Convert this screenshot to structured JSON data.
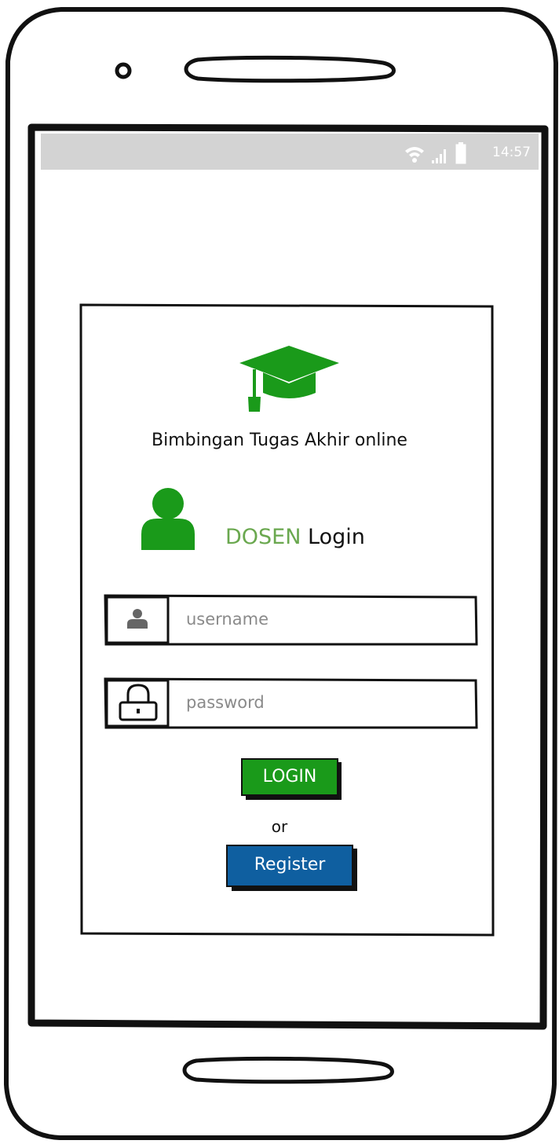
{
  "status_bar": {
    "time": "14:57",
    "icons": [
      "wifi-icon",
      "signal-icon",
      "battery-icon"
    ]
  },
  "app": {
    "title": "Bimbingan Tugas Akhir online",
    "logo_icon": "graduation-cap-icon"
  },
  "login": {
    "role_label": "DOSEN",
    "heading_label": "Login",
    "avatar_icon": "user-icon",
    "username": {
      "placeholder": "username",
      "value": "",
      "icon": "user-icon"
    },
    "password": {
      "placeholder": "password",
      "value": "",
      "icon": "lock-icon"
    },
    "login_button": "LOGIN",
    "separator": "or",
    "register_button": "Register"
  },
  "colors": {
    "brand_green": "#1a9a1a",
    "role_green": "#6aa84f",
    "register_blue": "#0f5fa0",
    "status_bar_gray": "#d3d3d3"
  }
}
